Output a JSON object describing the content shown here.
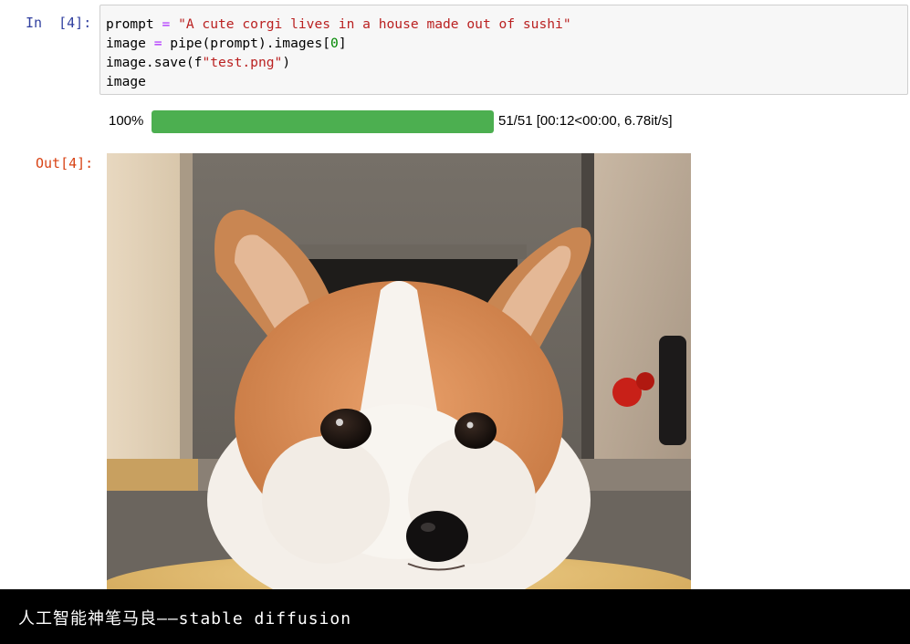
{
  "input_cell": {
    "prompt": "In  [4]:",
    "code_lines": [
      [
        {
          "t": "prompt",
          "c": "name"
        },
        {
          "t": " = ",
          "c": "op"
        },
        {
          "t": "\"A cute corgi lives in a house made out of sushi\"",
          "c": "str"
        }
      ],
      [
        {
          "t": "image ",
          "c": "name"
        },
        {
          "t": "= ",
          "c": "op"
        },
        {
          "t": "pipe(prompt).images[",
          "c": "name"
        },
        {
          "t": "0",
          "c": "num"
        },
        {
          "t": "]",
          "c": "name"
        }
      ],
      [
        {
          "t": "image.save(f",
          "c": "name"
        },
        {
          "t": "\"test.png\"",
          "c": "str"
        },
        {
          "t": ")",
          "c": "name"
        }
      ],
      [
        {
          "t": "image",
          "c": "name"
        }
      ]
    ]
  },
  "progress": {
    "percent_label": "100%",
    "fraction": 1.0,
    "stats": "51/51 [00:12<00:00, 6.78it/s]",
    "color": "#4caf50"
  },
  "output_cell": {
    "prompt": "Out[4]:",
    "image_subject": "corgi-dog-photo"
  },
  "caption": {
    "text": "人工智能神笔马良——stable diffusion"
  }
}
